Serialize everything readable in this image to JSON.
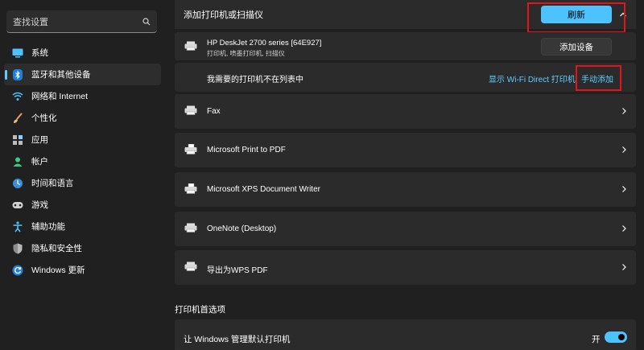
{
  "search": {
    "placeholder": "查找设置"
  },
  "sidebar": {
    "items": [
      {
        "label": "系统",
        "icon": "monitor-icon"
      },
      {
        "label": "蓝牙和其他设备",
        "icon": "bluetooth-icon",
        "active": true
      },
      {
        "label": "网络和 Internet",
        "icon": "wifi-icon"
      },
      {
        "label": "个性化",
        "icon": "brush-icon"
      },
      {
        "label": "应用",
        "icon": "apps-icon"
      },
      {
        "label": "帐户",
        "icon": "account-icon"
      },
      {
        "label": "时间和语言",
        "icon": "globe-clock-icon"
      },
      {
        "label": "游戏",
        "icon": "gamepad-icon"
      },
      {
        "label": "辅助功能",
        "icon": "accessibility-icon"
      },
      {
        "label": "隐私和安全性",
        "icon": "shield-icon"
      },
      {
        "label": "Windows 更新",
        "icon": "update-icon"
      }
    ]
  },
  "add_printer": {
    "title": "添加打印机或扫描仪",
    "refresh_label": "刷新",
    "found_device": {
      "name": "HP DeskJet 2700 series [64E927]",
      "subtitle": "打印机, 喷墨打印机, 扫描仪",
      "button_label": "添加设备"
    },
    "missing_text": "我需要的打印机不在列表中",
    "wifi_direct_label": "显示 Wi-Fi Direct 打印机",
    "manual_add_label": "手动添加"
  },
  "printers": [
    {
      "name": "Fax"
    },
    {
      "name": "Microsoft Print to PDF"
    },
    {
      "name": "Microsoft XPS Document Writer"
    },
    {
      "name": "OneNote (Desktop)"
    },
    {
      "name": "导出为WPS PDF"
    }
  ],
  "preferences": {
    "section_title": "打印机首选项",
    "default_label": "让 Windows 管理默认打印机",
    "toggle_state": "开",
    "toggle_on": true
  },
  "colors": {
    "accent": "#4cc2ff",
    "highlight": "#e3141b",
    "background": "#202020",
    "card": "#2b2b2b"
  }
}
